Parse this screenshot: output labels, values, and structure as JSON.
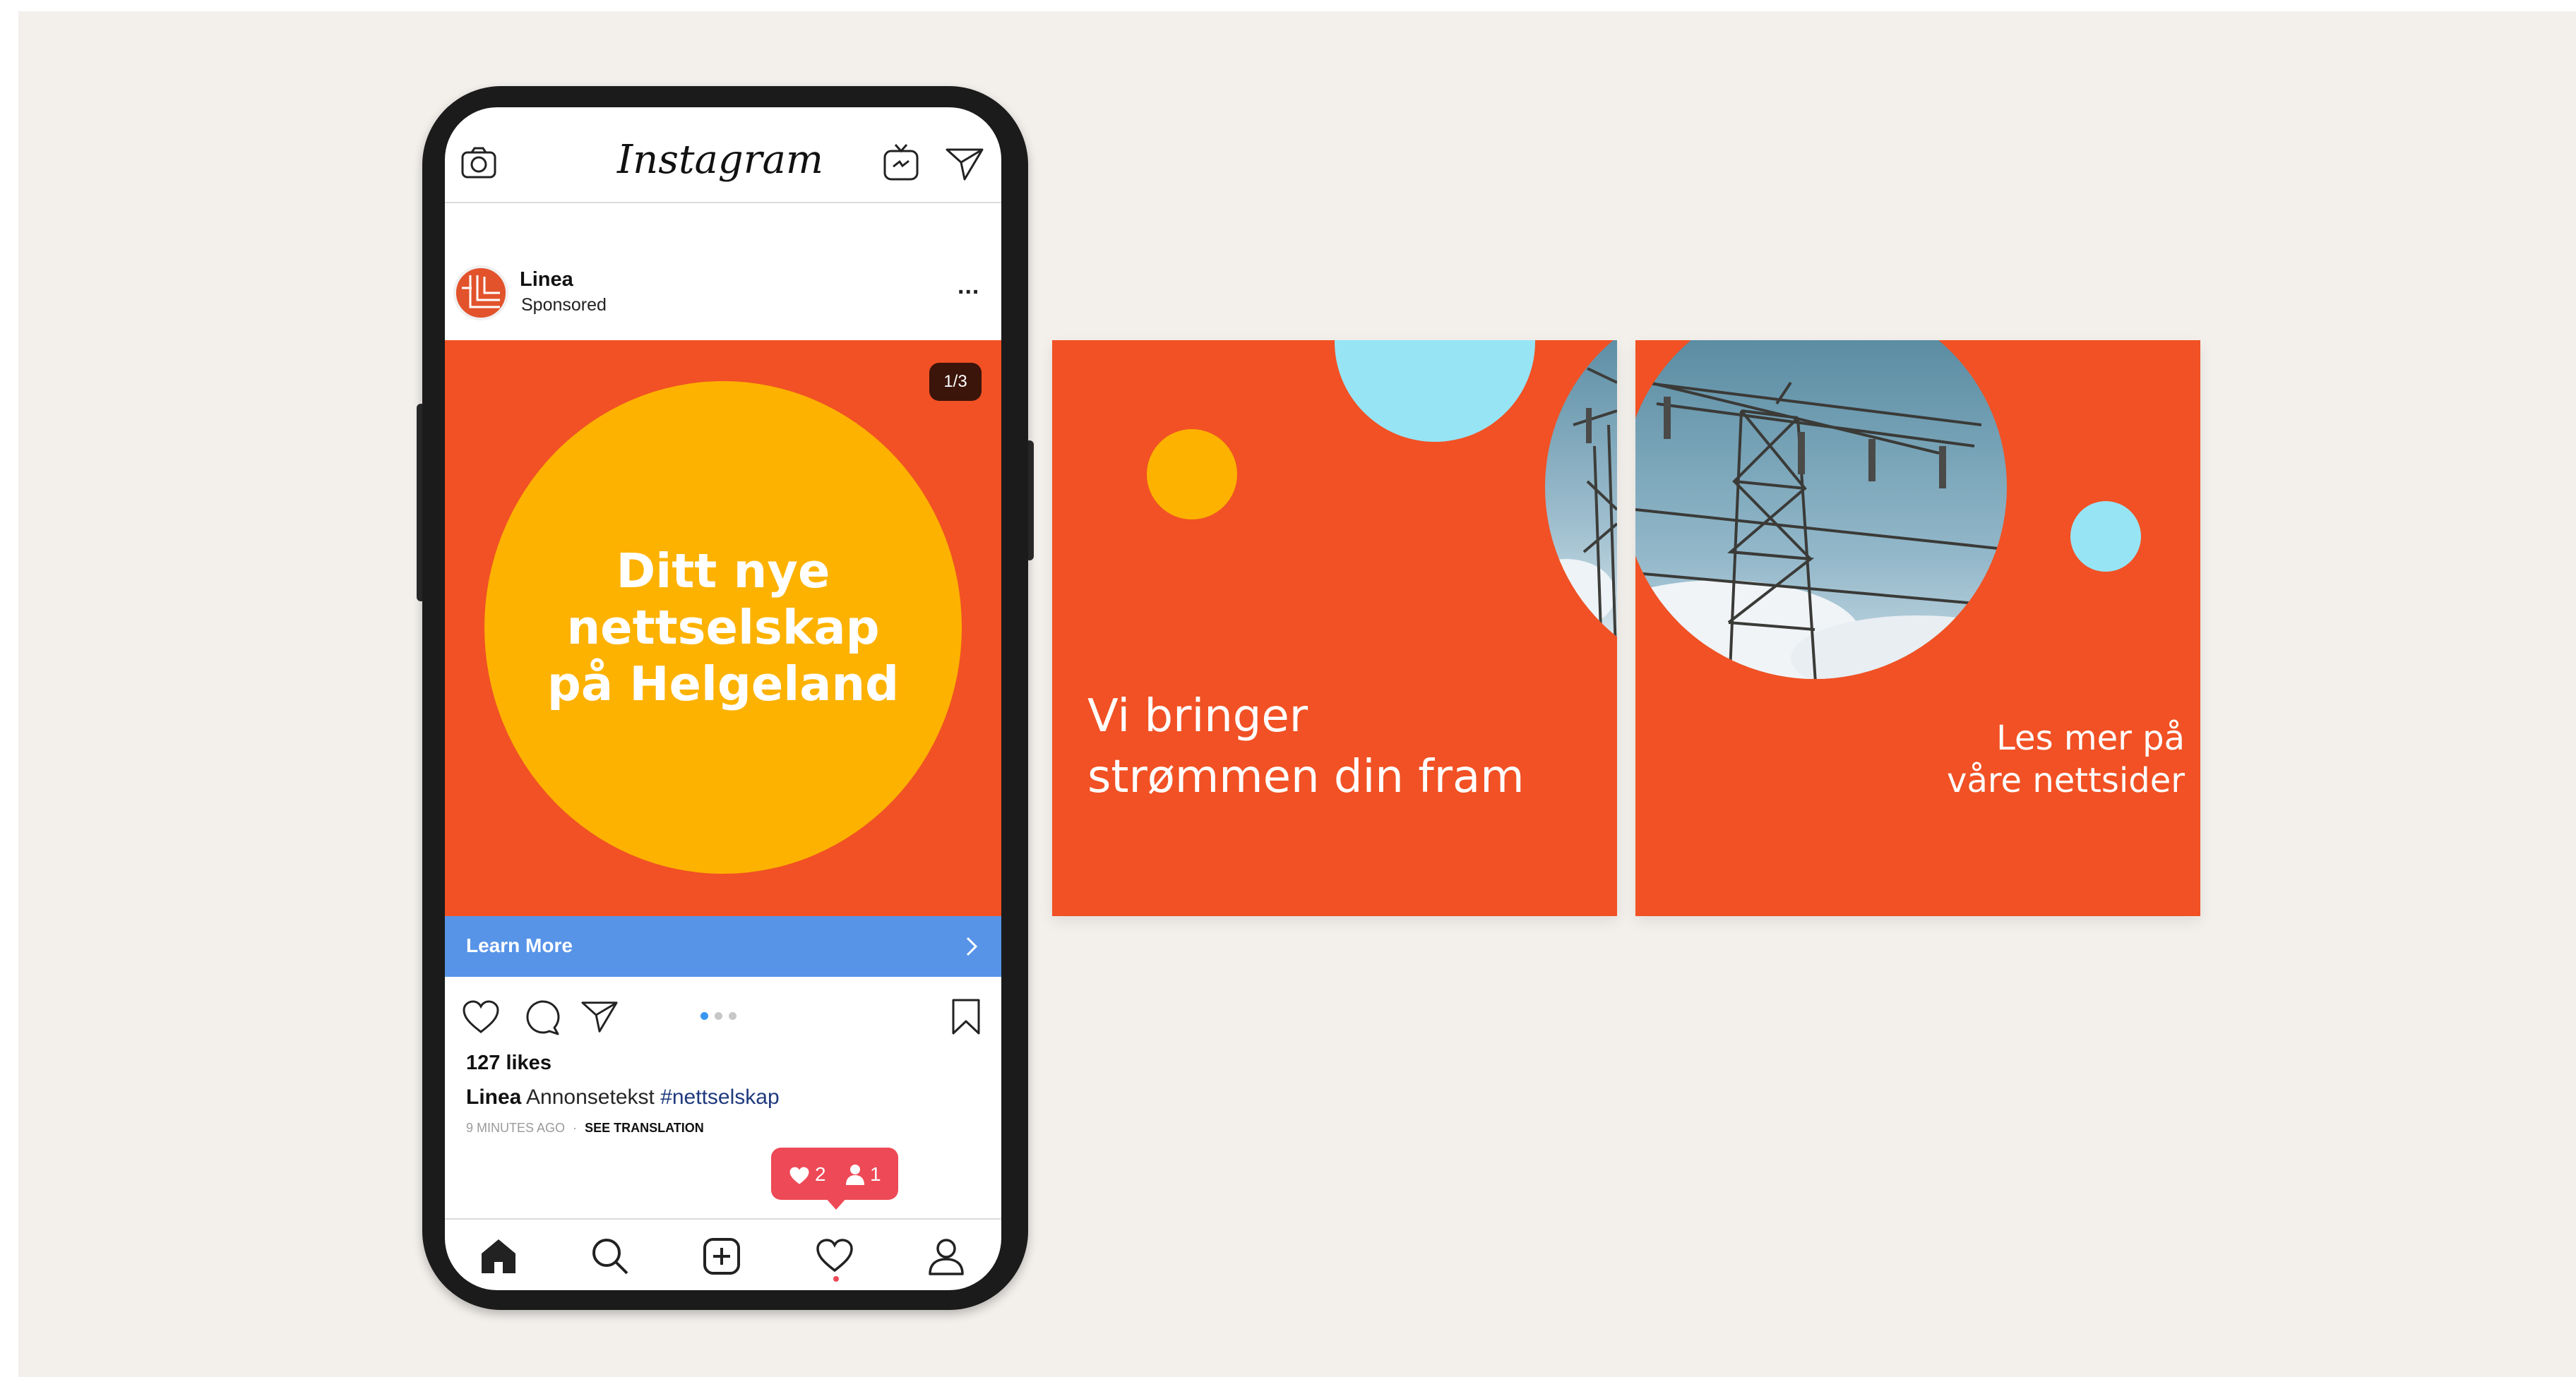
{
  "colors": {
    "background": "#f3f0ec",
    "brand_orange": "#f15124",
    "brand_yellow": "#fdb200",
    "brand_cyan": "#97e4f5",
    "cta_blue": "#5794e8",
    "notification_red": "#ed4956"
  },
  "app": {
    "logo_text": "Instagram",
    "header_icons": [
      "camera-icon",
      "igtv-icon",
      "direct-message-icon"
    ]
  },
  "post": {
    "account_name": "Linea",
    "sponsored_label": "Sponsored",
    "more_label": "...",
    "slide_counter": "1/3",
    "slide_index": 1,
    "slide_count": 3,
    "headline": "Ditt nye nettselskap\npå Helgeland",
    "cta_label": "Learn More",
    "likes": "127 likes",
    "caption_user": "Linea",
    "caption_text": "Annonsetekst",
    "caption_hashtag": "#nettselskap",
    "time_ago": "9 MINUTES AGO",
    "separator": "·",
    "see_translation": "SEE TRANSLATION"
  },
  "notification": {
    "likes_count": "2",
    "followers_count": "1"
  },
  "tabbar": {
    "items": [
      "home-icon",
      "search-icon",
      "new-post-icon",
      "activity-heart-icon",
      "profile-icon"
    ],
    "active": "home-icon"
  },
  "carousel": {
    "slide2_text": "Vi bringer\nstrømmen din fram",
    "slide3_text": "Les mer på\nvåre nettsider"
  }
}
